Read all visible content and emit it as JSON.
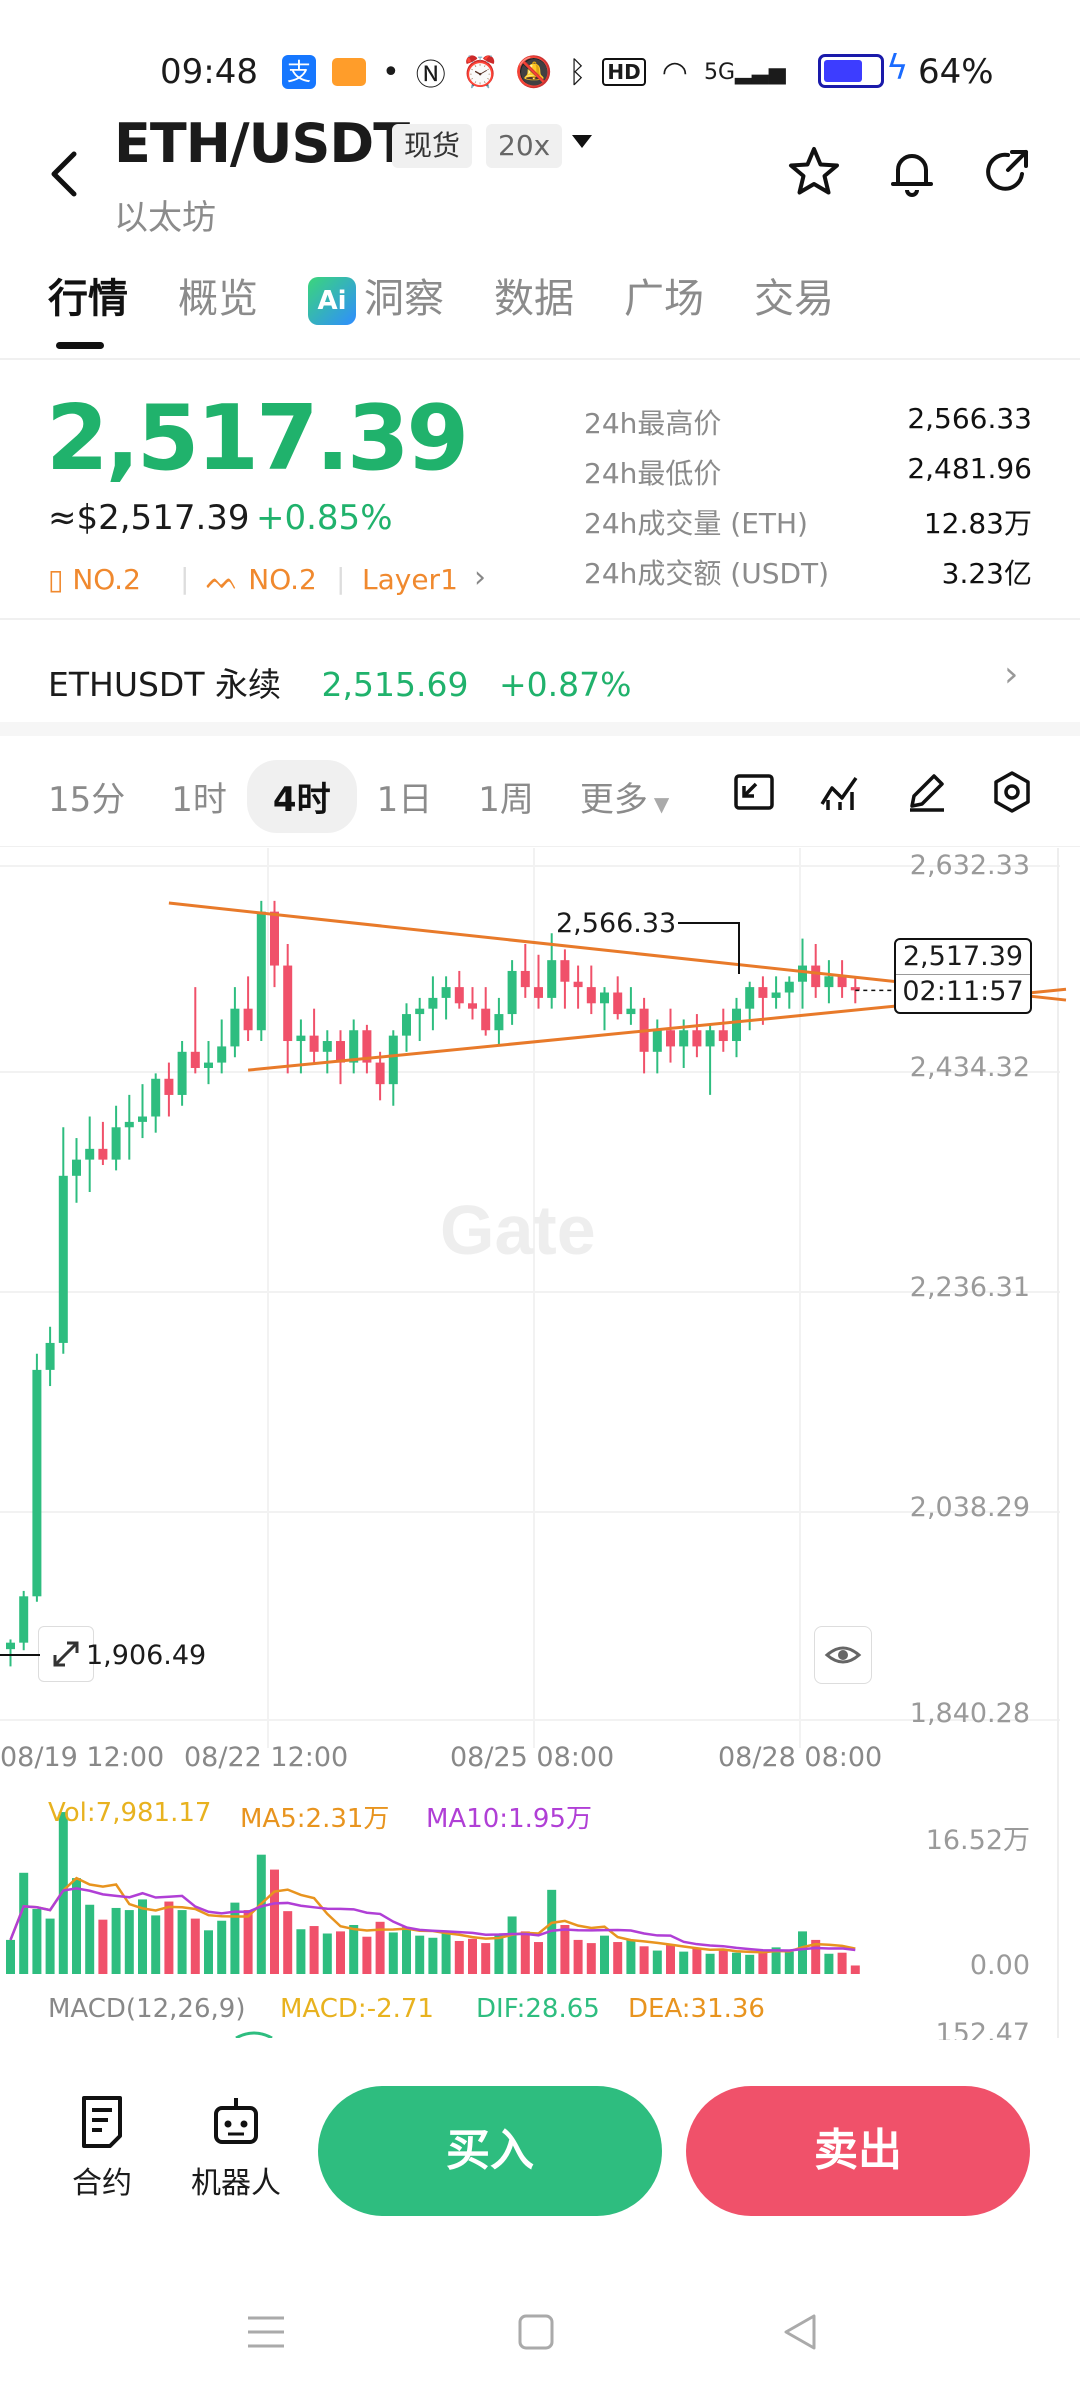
{
  "status_bar": {
    "time": "09:48",
    "network": "5G",
    "battery": "64%"
  },
  "header": {
    "title": "ETH/USDT",
    "market_tag": "现货",
    "leverage_tag": "20x",
    "subtitle": "以太坊"
  },
  "tabs": [
    {
      "label": "行情",
      "active": true
    },
    {
      "label": "概览"
    },
    {
      "label": "洞察"
    },
    {
      "label": "数据"
    },
    {
      "label": "广场"
    },
    {
      "label": "交易"
    }
  ],
  "ticker": {
    "price": "2,517.39",
    "usd_price": "≈$2,517.39",
    "change": "+0.85%",
    "rank1": "NO.2",
    "rank2": "NO.2",
    "category": "Layer1"
  },
  "stats": [
    {
      "label": "24h最高价",
      "value": "2,566.33"
    },
    {
      "label": "24h最低价",
      "value": "2,481.96"
    },
    {
      "label": "24h成交量 (ETH)",
      "value": "12.83万"
    },
    {
      "label": "24h成交额 (USDT)",
      "value": "3.23亿"
    }
  ],
  "perpetual": {
    "name": "ETHUSDT 永续",
    "price": "2,515.69",
    "change": "+0.87%"
  },
  "intervals": [
    "15分",
    "1时",
    "4时",
    "1日",
    "1周",
    "更多"
  ],
  "selected_interval": "4时",
  "chart": {
    "y_ticks": [
      "2,632.33",
      "2,434.32",
      "2,236.31",
      "2,038.29",
      "1,840.28"
    ],
    "x_ticks": [
      "08/19 12:00",
      "08/22 12:00",
      "08/25 08:00",
      "08/28 08:00"
    ],
    "high_marker": "2,566.33",
    "low_marker": "1,906.49",
    "last_price": "2,517.39",
    "countdown": "02:11:57",
    "watermark": "Gate"
  },
  "volume": {
    "vol_label": "Vol:7,981.17",
    "ma5_label": "MA5:2.31万",
    "ma10_label": "MA10:1.95万",
    "max_tick": "16.52万",
    "zero_tick": "0.00"
  },
  "macd": {
    "label": "MACD(12,26,9)",
    "macd": "MACD:-2.71",
    "dif": "DIF:28.65",
    "dea": "DEA:31.36",
    "tick": "152.47"
  },
  "bottom": {
    "contract_label": "合约",
    "bot_label": "机器人",
    "buy_label": "买入",
    "sell_label": "卖出"
  },
  "colors": {
    "up": "#2ebd7f",
    "down": "#f0516a",
    "trendline": "#e87a2a",
    "ma5": "#e8941f",
    "ma10": "#b03fd6"
  },
  "chart_data": {
    "type": "candlestick",
    "interval": "4h",
    "ylim": [
      1840.28,
      2632.33
    ],
    "candles": [
      [
        1906,
        1915,
        1890,
        1912
      ],
      [
        1912,
        1960,
        1905,
        1955
      ],
      [
        1955,
        2180,
        1950,
        2165
      ],
      [
        2165,
        2205,
        2150,
        2190
      ],
      [
        2190,
        2390,
        2180,
        2345
      ],
      [
        2345,
        2380,
        2320,
        2360
      ],
      [
        2360,
        2400,
        2330,
        2370
      ],
      [
        2370,
        2395,
        2355,
        2360
      ],
      [
        2360,
        2410,
        2350,
        2390
      ],
      [
        2390,
        2420,
        2360,
        2395
      ],
      [
        2395,
        2430,
        2380,
        2400
      ],
      [
        2400,
        2440,
        2385,
        2435
      ],
      [
        2435,
        2450,
        2400,
        2420
      ],
      [
        2420,
        2470,
        2410,
        2460
      ],
      [
        2460,
        2520,
        2440,
        2445
      ],
      [
        2445,
        2470,
        2430,
        2450
      ],
      [
        2450,
        2490,
        2440,
        2465
      ],
      [
        2465,
        2520,
        2455,
        2500
      ],
      [
        2500,
        2530,
        2470,
        2480
      ],
      [
        2480,
        2600,
        2470,
        2590
      ],
      [
        2590,
        2600,
        2520,
        2540
      ],
      [
        2540,
        2560,
        2440,
        2470
      ],
      [
        2470,
        2490,
        2440,
        2475
      ],
      [
        2475,
        2500,
        2450,
        2460
      ],
      [
        2460,
        2480,
        2440,
        2470
      ],
      [
        2470,
        2480,
        2430,
        2450
      ],
      [
        2450,
        2490,
        2440,
        2480
      ],
      [
        2480,
        2485,
        2440,
        2450
      ],
      [
        2450,
        2460,
        2415,
        2430
      ],
      [
        2430,
        2480,
        2410,
        2475
      ],
      [
        2475,
        2505,
        2460,
        2495
      ],
      [
        2495,
        2510,
        2470,
        2500
      ],
      [
        2500,
        2530,
        2480,
        2510
      ],
      [
        2510,
        2530,
        2490,
        2520
      ],
      [
        2520,
        2535,
        2500,
        2505
      ],
      [
        2505,
        2520,
        2490,
        2500
      ],
      [
        2500,
        2520,
        2475,
        2480
      ],
      [
        2480,
        2510,
        2465,
        2495
      ],
      [
        2495,
        2545,
        2485,
        2535
      ],
      [
        2535,
        2560,
        2510,
        2520
      ],
      [
        2520,
        2550,
        2500,
        2510
      ],
      [
        2510,
        2570,
        2500,
        2545
      ],
      [
        2545,
        2555,
        2500,
        2525
      ],
      [
        2525,
        2540,
        2500,
        2520
      ],
      [
        2520,
        2540,
        2495,
        2505
      ],
      [
        2505,
        2520,
        2480,
        2515
      ],
      [
        2515,
        2530,
        2490,
        2495
      ],
      [
        2495,
        2520,
        2485,
        2500
      ],
      [
        2500,
        2510,
        2440,
        2460
      ],
      [
        2460,
        2490,
        2440,
        2480
      ],
      [
        2480,
        2500,
        2450,
        2465
      ],
      [
        2465,
        2490,
        2445,
        2480
      ],
      [
        2480,
        2495,
        2455,
        2465
      ],
      [
        2465,
        2485,
        2420,
        2480
      ],
      [
        2480,
        2500,
        2460,
        2470
      ],
      [
        2470,
        2510,
        2455,
        2500
      ],
      [
        2500,
        2525,
        2480,
        2520
      ],
      [
        2520,
        2530,
        2485,
        2510
      ],
      [
        2510,
        2530,
        2500,
        2515
      ],
      [
        2515,
        2530,
        2500,
        2525
      ],
      [
        2525,
        2565,
        2500,
        2540
      ],
      [
        2540,
        2560,
        2510,
        2520
      ],
      [
        2520,
        2545,
        2505,
        2530
      ],
      [
        2530,
        2545,
        2510,
        2520
      ],
      [
        2520,
        2530,
        2505,
        2517
      ]
    ],
    "volumes": [
      3.2,
      9.5,
      6.1,
      5.2,
      15.2,
      9.0,
      6.5,
      5.1,
      6.2,
      6.0,
      7.0,
      5.5,
      6.8,
      6.0,
      5.2,
      4.1,
      5.0,
      6.7,
      6.0,
      11.2,
      9.8,
      5.9,
      4.2,
      4.5,
      3.8,
      4.0,
      4.6,
      3.5,
      4.9,
      3.9,
      4.4,
      3.6,
      3.4,
      3.9,
      3.1,
      3.3,
      2.9,
      3.7,
      5.4,
      4.0,
      3.0,
      7.9,
      4.6,
      3.2,
      2.9,
      3.6,
      3.0,
      3.2,
      2.6,
      2.2,
      2.8,
      2.1,
      2.4,
      1.9,
      2.3,
      2.0,
      1.8,
      2.2,
      2.5,
      2.1,
      4.0,
      3.2,
      1.9,
      2.0,
      0.8
    ]
  }
}
